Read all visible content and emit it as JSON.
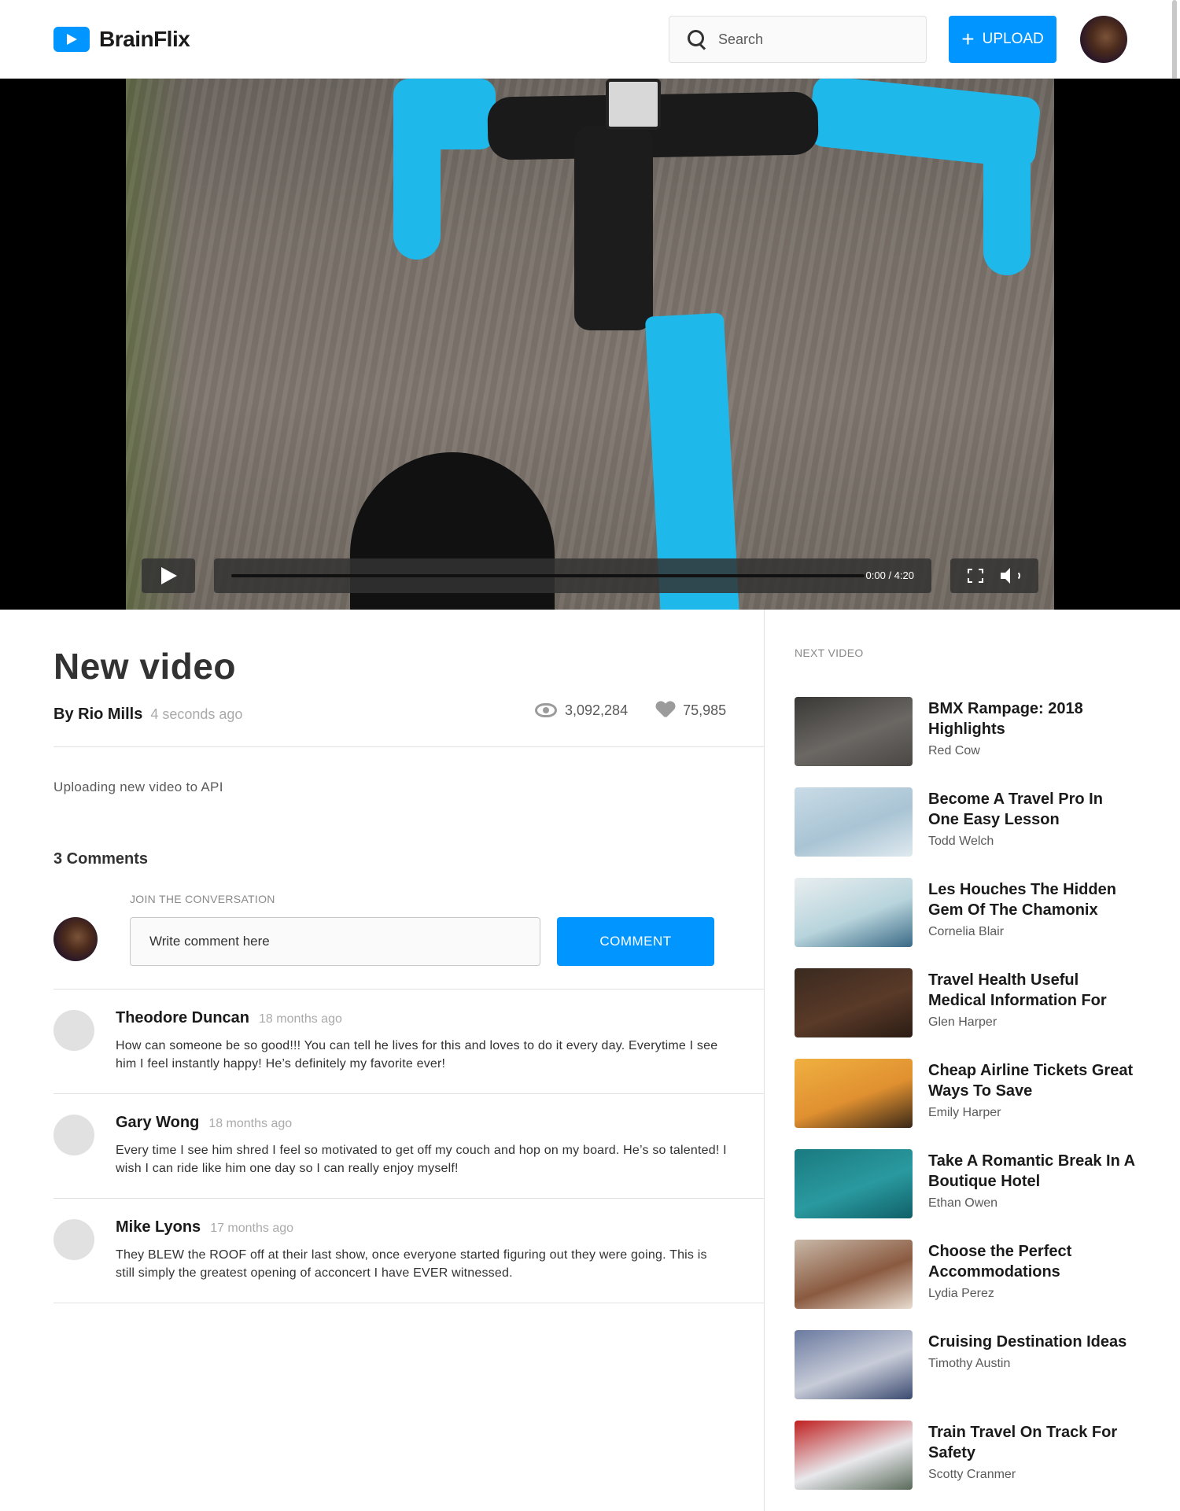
{
  "header": {
    "brand": "BrainFlix",
    "search_placeholder": "Search",
    "upload_label": "UPLOAD"
  },
  "player": {
    "time": "0:00 / 4:20",
    "progress": 0
  },
  "video": {
    "title": "New video",
    "author": "By Rio Mills",
    "timestamp": "4 seconds ago",
    "views": "3,092,284",
    "likes": "75,985",
    "description": "Uploading new video to API"
  },
  "comments": {
    "count_label": "3 Comments",
    "join_label": "JOIN THE CONVERSATION",
    "input_placeholder": "Write comment here",
    "button_label": "COMMENT",
    "items": [
      {
        "name": "Theodore Duncan",
        "time": "18 months ago",
        "text": "How can someone be so good!!! You can tell he lives for this and loves to do it every day. Everytime I see him I feel instantly happy! He’s definitely my favorite ever!"
      },
      {
        "name": "Gary Wong",
        "time": "18 months ago",
        "text": "Every time I see him shred I feel so motivated to get off my couch and hop on my board. He’s so talented! I wish I can ride like him one day so I can really enjoy myself!"
      },
      {
        "name": "Mike Lyons",
        "time": "17 months ago",
        "text": "They BLEW the ROOF off at their last show, once everyone started figuring out they were going. This is still simply the greatest opening of acconcert I have EVER witnessed."
      }
    ]
  },
  "next_videos": {
    "label": "NEXT VIDEO",
    "items": [
      {
        "title": "BMX Rampage: 2018 Highlights",
        "author": "Red Cow",
        "thumb_colors": [
          "#3a3836",
          "#6b6864",
          "#4a4744"
        ]
      },
      {
        "title": "Become A Travel Pro In One Easy Lesson",
        "author": "Todd Welch",
        "thumb_colors": [
          "#c9dbe6",
          "#a9c4d4",
          "#dfe9ef"
        ]
      },
      {
        "title": "Les Houches The Hidden Gem Of The Chamonix",
        "author": "Cornelia Blair",
        "thumb_colors": [
          "#e8eef0",
          "#b8d4dc",
          "#3a6a86"
        ]
      },
      {
        "title": "Travel Health Useful Medical Information For",
        "author": "Glen Harper",
        "thumb_colors": [
          "#3a2a20",
          "#5a3a28",
          "#2a1c14"
        ]
      },
      {
        "title": "Cheap Airline Tickets Great Ways To Save",
        "author": "Emily Harper",
        "thumb_colors": [
          "#f0b040",
          "#e09030",
          "#3a2818"
        ]
      },
      {
        "title": "Take A Romantic Break In A Boutique Hotel",
        "author": "Ethan Owen",
        "thumb_colors": [
          "#1a7a80",
          "#2a9aa0",
          "#106068"
        ]
      },
      {
        "title": "Choose the Perfect Accommodations",
        "author": "Lydia Perez",
        "thumb_colors": [
          "#c8b8a8",
          "#8a5a40",
          "#e8dcd0"
        ]
      },
      {
        "title": "Cruising Destination Ideas",
        "author": "Timothy Austin",
        "thumb_colors": [
          "#6a7aa0",
          "#c8ccd8",
          "#3a4a70"
        ]
      },
      {
        "title": "Train Travel On Track For Safety",
        "author": "Scotty Cranmer",
        "thumb_colors": [
          "#c02020",
          "#e8e8ec",
          "#5a6a5a"
        ]
      }
    ]
  }
}
